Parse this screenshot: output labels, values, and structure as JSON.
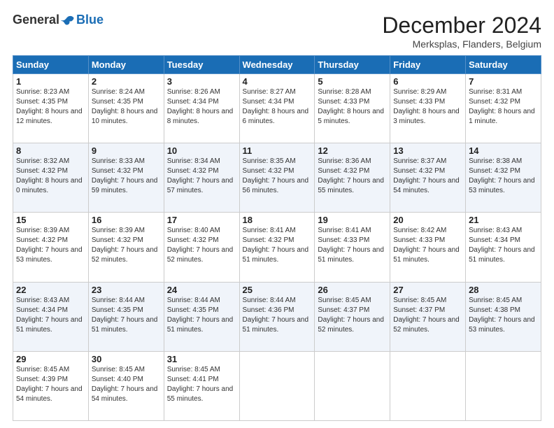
{
  "logo": {
    "text_general": "General",
    "text_blue": "Blue"
  },
  "header": {
    "month_title": "December 2024",
    "location": "Merksplas, Flanders, Belgium"
  },
  "days_of_week": [
    "Sunday",
    "Monday",
    "Tuesday",
    "Wednesday",
    "Thursday",
    "Friday",
    "Saturday"
  ],
  "weeks": [
    [
      {
        "day": "1",
        "sunrise": "8:23 AM",
        "sunset": "4:35 PM",
        "daylight": "8 hours and 12 minutes."
      },
      {
        "day": "2",
        "sunrise": "8:24 AM",
        "sunset": "4:35 PM",
        "daylight": "8 hours and 10 minutes."
      },
      {
        "day": "3",
        "sunrise": "8:26 AM",
        "sunset": "4:34 PM",
        "daylight": "8 hours and 8 minutes."
      },
      {
        "day": "4",
        "sunrise": "8:27 AM",
        "sunset": "4:34 PM",
        "daylight": "8 hours and 6 minutes."
      },
      {
        "day": "5",
        "sunrise": "8:28 AM",
        "sunset": "4:33 PM",
        "daylight": "8 hours and 5 minutes."
      },
      {
        "day": "6",
        "sunrise": "8:29 AM",
        "sunset": "4:33 PM",
        "daylight": "8 hours and 3 minutes."
      },
      {
        "day": "7",
        "sunrise": "8:31 AM",
        "sunset": "4:32 PM",
        "daylight": "8 hours and 1 minute."
      }
    ],
    [
      {
        "day": "8",
        "sunrise": "8:32 AM",
        "sunset": "4:32 PM",
        "daylight": "8 hours and 0 minutes."
      },
      {
        "day": "9",
        "sunrise": "8:33 AM",
        "sunset": "4:32 PM",
        "daylight": "7 hours and 59 minutes."
      },
      {
        "day": "10",
        "sunrise": "8:34 AM",
        "sunset": "4:32 PM",
        "daylight": "7 hours and 57 minutes."
      },
      {
        "day": "11",
        "sunrise": "8:35 AM",
        "sunset": "4:32 PM",
        "daylight": "7 hours and 56 minutes."
      },
      {
        "day": "12",
        "sunrise": "8:36 AM",
        "sunset": "4:32 PM",
        "daylight": "7 hours and 55 minutes."
      },
      {
        "day": "13",
        "sunrise": "8:37 AM",
        "sunset": "4:32 PM",
        "daylight": "7 hours and 54 minutes."
      },
      {
        "day": "14",
        "sunrise": "8:38 AM",
        "sunset": "4:32 PM",
        "daylight": "7 hours and 53 minutes."
      }
    ],
    [
      {
        "day": "15",
        "sunrise": "8:39 AM",
        "sunset": "4:32 PM",
        "daylight": "7 hours and 53 minutes."
      },
      {
        "day": "16",
        "sunrise": "8:39 AM",
        "sunset": "4:32 PM",
        "daylight": "7 hours and 52 minutes."
      },
      {
        "day": "17",
        "sunrise": "8:40 AM",
        "sunset": "4:32 PM",
        "daylight": "7 hours and 52 minutes."
      },
      {
        "day": "18",
        "sunrise": "8:41 AM",
        "sunset": "4:32 PM",
        "daylight": "7 hours and 51 minutes."
      },
      {
        "day": "19",
        "sunrise": "8:41 AM",
        "sunset": "4:33 PM",
        "daylight": "7 hours and 51 minutes."
      },
      {
        "day": "20",
        "sunrise": "8:42 AM",
        "sunset": "4:33 PM",
        "daylight": "7 hours and 51 minutes."
      },
      {
        "day": "21",
        "sunrise": "8:43 AM",
        "sunset": "4:34 PM",
        "daylight": "7 hours and 51 minutes."
      }
    ],
    [
      {
        "day": "22",
        "sunrise": "8:43 AM",
        "sunset": "4:34 PM",
        "daylight": "7 hours and 51 minutes."
      },
      {
        "day": "23",
        "sunrise": "8:44 AM",
        "sunset": "4:35 PM",
        "daylight": "7 hours and 51 minutes."
      },
      {
        "day": "24",
        "sunrise": "8:44 AM",
        "sunset": "4:35 PM",
        "daylight": "7 hours and 51 minutes."
      },
      {
        "day": "25",
        "sunrise": "8:44 AM",
        "sunset": "4:36 PM",
        "daylight": "7 hours and 51 minutes."
      },
      {
        "day": "26",
        "sunrise": "8:45 AM",
        "sunset": "4:37 PM",
        "daylight": "7 hours and 52 minutes."
      },
      {
        "day": "27",
        "sunrise": "8:45 AM",
        "sunset": "4:37 PM",
        "daylight": "7 hours and 52 minutes."
      },
      {
        "day": "28",
        "sunrise": "8:45 AM",
        "sunset": "4:38 PM",
        "daylight": "7 hours and 53 minutes."
      }
    ],
    [
      {
        "day": "29",
        "sunrise": "8:45 AM",
        "sunset": "4:39 PM",
        "daylight": "7 hours and 54 minutes."
      },
      {
        "day": "30",
        "sunrise": "8:45 AM",
        "sunset": "4:40 PM",
        "daylight": "7 hours and 54 minutes."
      },
      {
        "day": "31",
        "sunrise": "8:45 AM",
        "sunset": "4:41 PM",
        "daylight": "7 hours and 55 minutes."
      },
      null,
      null,
      null,
      null
    ]
  ]
}
